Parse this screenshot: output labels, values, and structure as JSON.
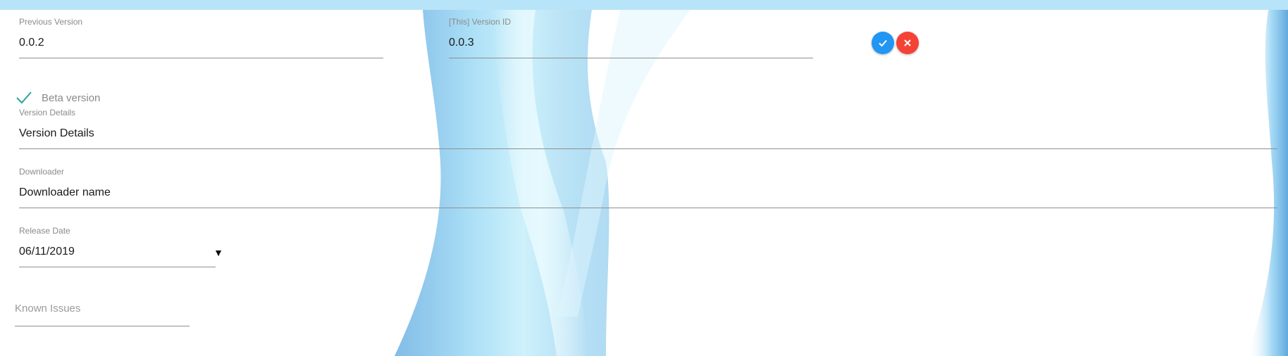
{
  "form": {
    "previous_version": {
      "label": "Previous Version",
      "value": "0.0.2"
    },
    "this_version": {
      "label": "[This] Version ID",
      "value": "0.0.3"
    },
    "actions": {
      "confirm_icon": "check-icon",
      "cancel_icon": "close-icon",
      "confirm_color": "#2196f3",
      "cancel_color": "#f44336"
    },
    "beta": {
      "label": "Beta version",
      "checked": true,
      "check_color": "#26a69a"
    },
    "version_details": {
      "label": "Version Details",
      "value": "Version Details"
    },
    "downloader": {
      "label": "Downloader",
      "value": "Downloader name"
    },
    "release_date": {
      "label": "Release Date",
      "value": "06/11/2019",
      "dropdown_icon": "caret-down-icon"
    },
    "known_issues": {
      "placeholder": "Known Issues"
    }
  },
  "theme": {
    "top_strip_color": "#b8e4f9",
    "wallpaper_color": "#9dd3f0"
  }
}
